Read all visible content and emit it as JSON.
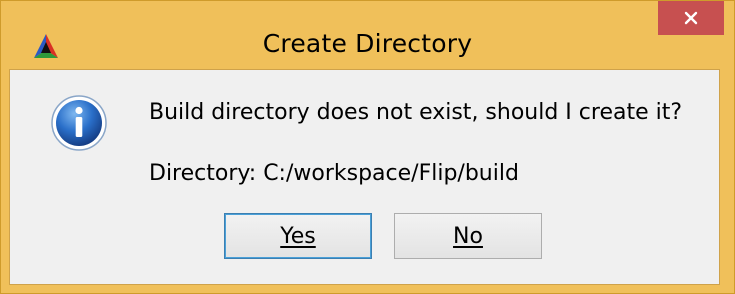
{
  "window": {
    "title": "Create Directory",
    "app_icon": "cmake-triangle-icon",
    "close_icon": "close-icon"
  },
  "dialog": {
    "icon": "info-icon",
    "message": "Build directory does not exist, should I create it?",
    "directory": "Directory: C:/workspace/Flip/build"
  },
  "buttons": {
    "yes_label": "Yes",
    "no_label": "No"
  },
  "colors": {
    "frame": "#f0c05a",
    "close_button": "#c75050",
    "client": "#f0f0f0",
    "default_button_border": "#3c7fb1"
  }
}
